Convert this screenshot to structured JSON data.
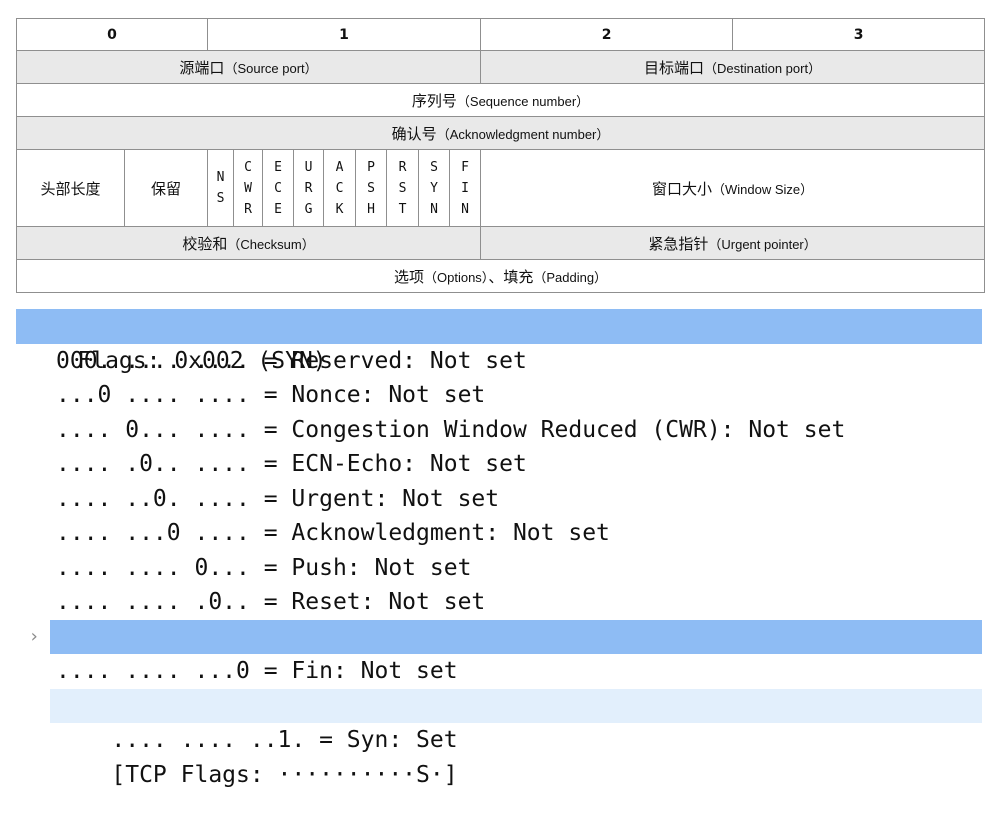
{
  "table": {
    "octets": [
      "0",
      "1",
      "2",
      "3"
    ],
    "source_port": {
      "zh": "源端口",
      "en": "（Source port）"
    },
    "dest_port": {
      "zh": "目标端口",
      "en": "（Destination port）"
    },
    "seq": {
      "zh": "序列号",
      "en": "（Sequence number）"
    },
    "ack": {
      "zh": "确认号",
      "en": "（Acknowledgment number）"
    },
    "header_len": "头部长度",
    "reserved": "保留",
    "flags": [
      {
        "name": "NS",
        "letters": [
          "N",
          "S"
        ]
      },
      {
        "name": "CWR",
        "letters": [
          "C",
          "W",
          "R"
        ]
      },
      {
        "name": "ECE",
        "letters": [
          "E",
          "C",
          "E"
        ]
      },
      {
        "name": "URG",
        "letters": [
          "U",
          "R",
          "G"
        ]
      },
      {
        "name": "ACK",
        "letters": [
          "A",
          "C",
          "K"
        ]
      },
      {
        "name": "PSH",
        "letters": [
          "P",
          "S",
          "H"
        ]
      },
      {
        "name": "RST",
        "letters": [
          "R",
          "S",
          "T"
        ]
      },
      {
        "name": "SYN",
        "letters": [
          "S",
          "Y",
          "N"
        ]
      },
      {
        "name": "FIN",
        "letters": [
          "F",
          "I",
          "N"
        ]
      }
    ],
    "window": {
      "zh": "窗口大小",
      "en": "（Window Size）"
    },
    "checksum": {
      "zh": "校验和",
      "en": "（Checksum）"
    },
    "urgent": {
      "zh": "紧急指针",
      "en": "（Urgent pointer）"
    },
    "options": {
      "zh1": "选项",
      "en1": "（Options）",
      "sep": "、",
      "zh2": "填充",
      "en2": "（Padding）"
    }
  },
  "tree": {
    "header": "Flags: 0x002 (SYN)",
    "rows": [
      {
        "name": "reserved",
        "text": "000. .... .... = Reserved: Not set"
      },
      {
        "name": "nonce",
        "text": "...0 .... .... = Nonce: Not set"
      },
      {
        "name": "cwr",
        "text": ".... 0... .... = Congestion Window Reduced (CWR): Not set"
      },
      {
        "name": "ecn-echo",
        "text": ".... .0.. .... = ECN-Echo: Not set"
      },
      {
        "name": "urgent",
        "text": ".... ..0. .... = Urgent: Not set"
      },
      {
        "name": "acknowledgment",
        "text": ".... ...0 .... = Acknowledgment: Not set"
      },
      {
        "name": "push",
        "text": ".... .... 0... = Push: Not set"
      },
      {
        "name": "reset",
        "text": ".... .... .0.. = Reset: Not set"
      },
      {
        "name": "syn",
        "text": ".... .... ..1. = Syn: Set"
      },
      {
        "name": "fin",
        "text": ".... .... ...0 = Fin: Not set"
      }
    ],
    "tcp_flags": "[TCP Flags: ··········S·]"
  }
}
